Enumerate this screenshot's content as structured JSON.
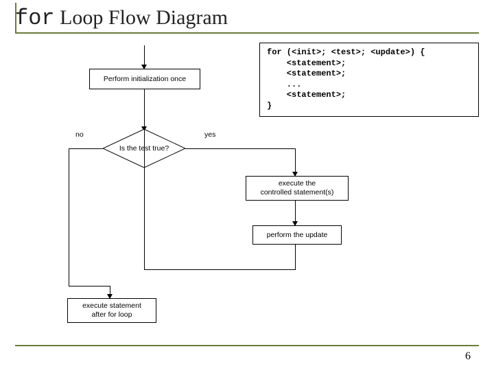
{
  "title": {
    "prefix": "for",
    "rest": " Loop Flow Diagram"
  },
  "code": "for (<init>; <test>; <update>) {\n    <statement>;\n    <statement>;\n    ...\n    <statement>;\n}",
  "flow": {
    "init_box": "Perform initialization once",
    "test_diamond": "Is the test true?",
    "yes": "yes",
    "no": "no",
    "exec_box": "execute the\ncontrolled statement(s)",
    "update_box": "perform the update",
    "after_box": "execute statement\nafter for loop"
  },
  "page_number": "6"
}
